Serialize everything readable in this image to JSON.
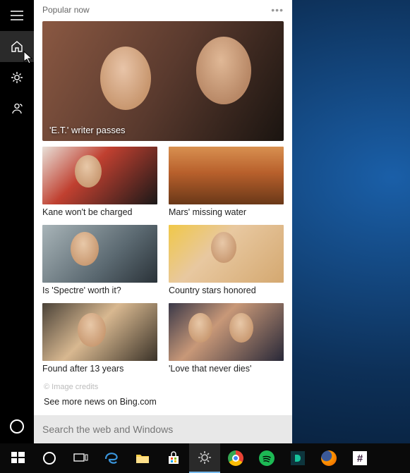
{
  "panel": {
    "header_title": "Popular now",
    "hero_caption": "'E.T.' writer passes",
    "tiles": [
      {
        "caption": "Kane won't be charged"
      },
      {
        "caption": "Mars' missing water"
      },
      {
        "caption": "Is 'Spectre' worth it?"
      },
      {
        "caption": "Country stars honored"
      },
      {
        "caption": "Found after 13 years"
      },
      {
        "caption": "'Love that never dies'"
      }
    ],
    "credits": "© Image credits",
    "more_link": "See more news on Bing.com",
    "search_placeholder": "Search the web and Windows"
  },
  "sidebar": {
    "items": [
      "menu",
      "home",
      "settings",
      "feedback",
      "cortana"
    ]
  },
  "taskbar": {
    "apps": [
      "start",
      "cortana",
      "taskview",
      "edge",
      "file-explorer",
      "store",
      "windows-settings",
      "chrome",
      "spotify",
      "dashlane",
      "firefox",
      "slack"
    ]
  }
}
